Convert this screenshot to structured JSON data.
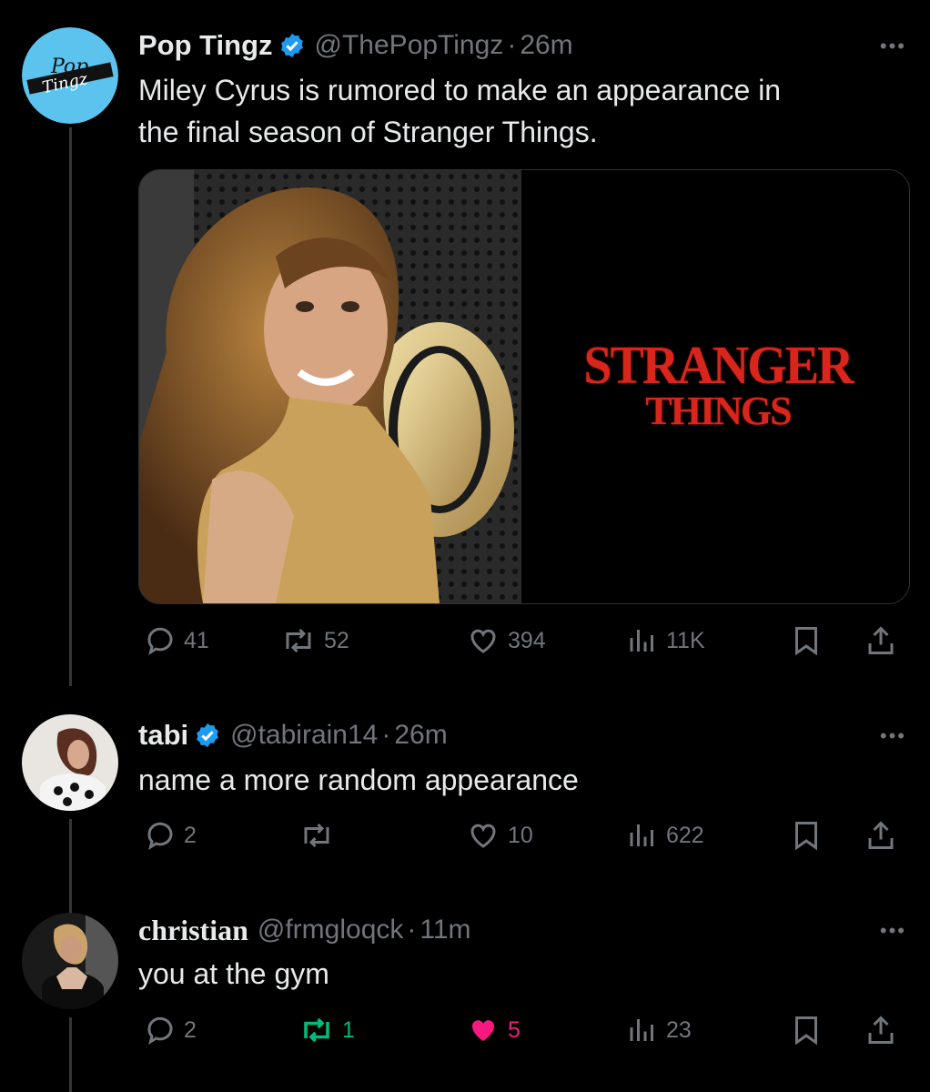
{
  "tweets": [
    {
      "name": "Pop Tingz",
      "handle": "@ThePopTingz",
      "time": "26m",
      "text_lines": [
        "Miley Cyrus is rumored to make an appearance in",
        "the final season of Stranger Things."
      ],
      "avatar_text": [
        "Pop",
        "Tingz"
      ],
      "media_logo": [
        "STRANGER",
        "THINGS"
      ],
      "replies": "41",
      "reposts": "52",
      "likes": "394",
      "views": "11K",
      "verified": true
    },
    {
      "name": "tabi",
      "handle": "@tabirain14",
      "time": "26m",
      "text": "name a more random appearance",
      "replies": "2",
      "reposts": "",
      "likes": "10",
      "views": "622",
      "verified": true
    },
    {
      "name": "christian",
      "handle": "@frmgloqck",
      "time": "11m",
      "text": "you at the gym",
      "replies": "2",
      "reposts": "1",
      "likes": "5",
      "views": "23",
      "verified": false,
      "reposted": true,
      "liked": true
    }
  ],
  "ui": {
    "dot": "·",
    "more": "•••"
  },
  "colors": {
    "background": "#000000",
    "muted": "#71767b",
    "verified": "#1d9bf0",
    "repost_active": "#00ba7c",
    "like_active": "#f91880"
  }
}
